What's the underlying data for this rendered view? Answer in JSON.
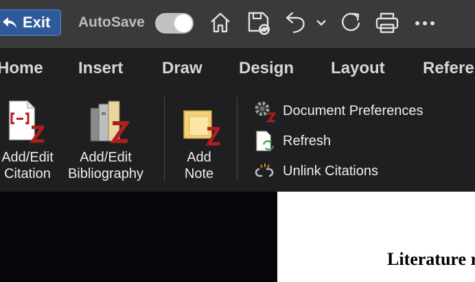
{
  "titlebar": {
    "exit_label": "Exit",
    "autosave_label": "AutoSave",
    "autosave_on": true,
    "icons": [
      "home-icon",
      "save-sync-icon",
      "undo-icon",
      "chevron-down-icon",
      "redo-icon",
      "print-icon",
      "more-icon"
    ]
  },
  "tabs": [
    "Home",
    "Insert",
    "Draw",
    "Design",
    "Layout",
    "Refere"
  ],
  "ribbon": {
    "add_edit_citation": [
      "Add/Edit",
      "Citation"
    ],
    "add_edit_bibliography": [
      "Add/Edit",
      "Bibliography"
    ],
    "add_note": [
      "Add",
      "Note"
    ],
    "document_preferences": "Document Preferences",
    "refresh": "Refresh",
    "unlink_citations": "Unlink Citations"
  },
  "document": {
    "heading": "Literature r"
  },
  "colors": {
    "exit_button": "#2e5a9a",
    "zotero_red": "#b01e1e",
    "titlebar": "#3a3a3c",
    "ribbon": "#1f1f21"
  }
}
